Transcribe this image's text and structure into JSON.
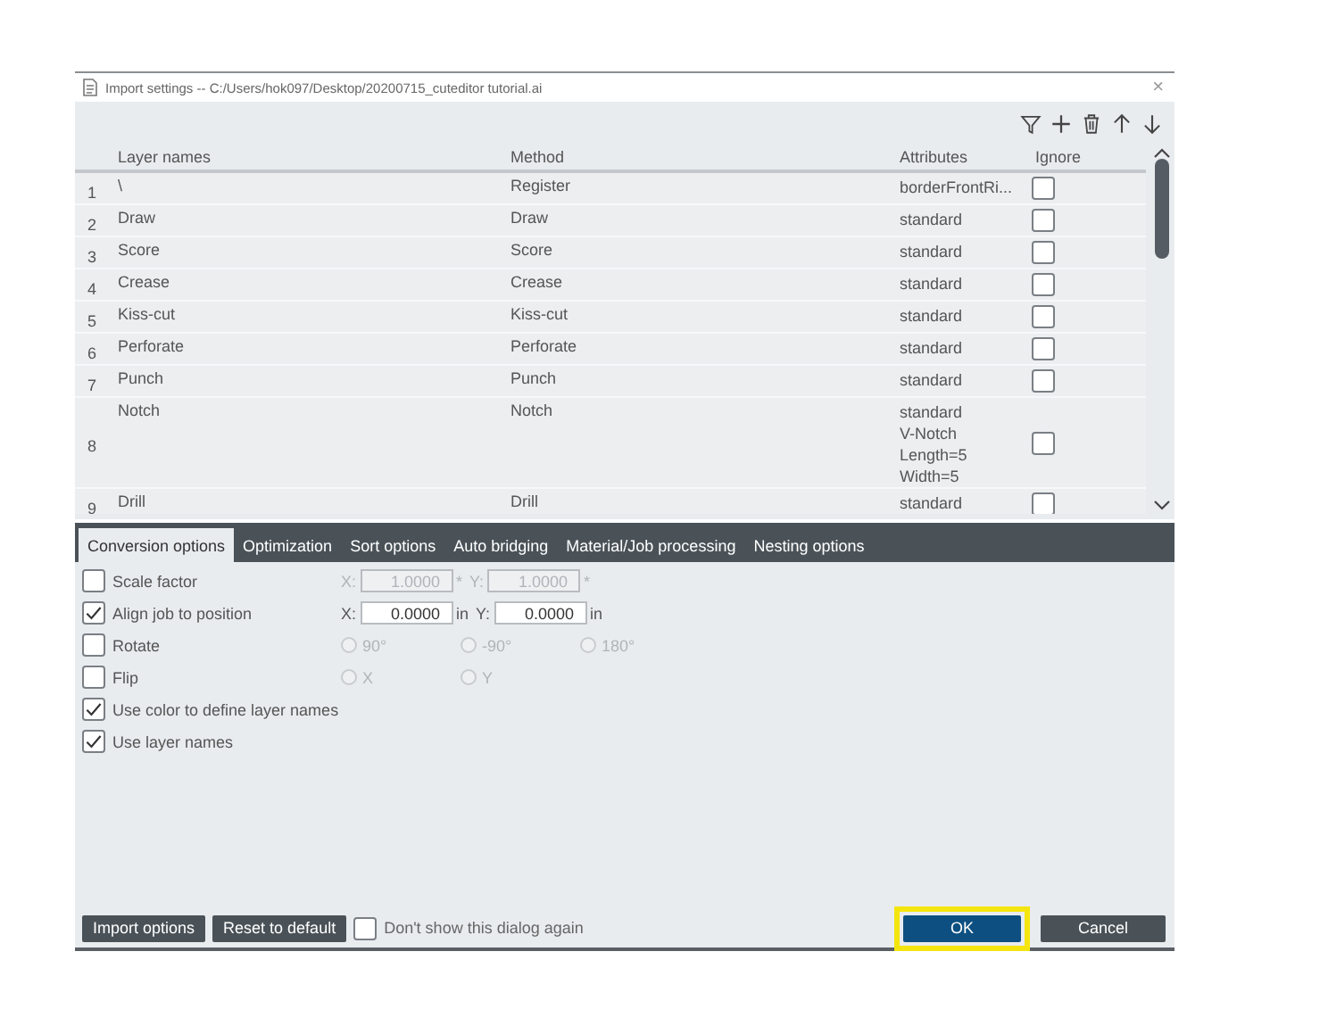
{
  "window": {
    "title": "Import settings  --  C:/Users/hok097/Desktop/20200715_cuteditor tutorial.ai",
    "close": "×"
  },
  "table": {
    "columns": [
      "Layer names",
      "Method",
      "Attributes",
      "Ignore"
    ],
    "rows": [
      {
        "number": "1",
        "layer": "\\",
        "method": "Register",
        "attributes": [
          "borderFrontRi..."
        ],
        "ignore": false
      },
      {
        "number": "2",
        "layer": "Draw",
        "method": "Draw",
        "attributes": [
          "standard"
        ],
        "ignore": false
      },
      {
        "number": "3",
        "layer": "Score",
        "method": "Score",
        "attributes": [
          "standard"
        ],
        "ignore": false
      },
      {
        "number": "4",
        "layer": "Crease",
        "method": "Crease",
        "attributes": [
          "standard"
        ],
        "ignore": false
      },
      {
        "number": "5",
        "layer": "Kiss-cut",
        "method": "Kiss-cut",
        "attributes": [
          "standard"
        ],
        "ignore": false
      },
      {
        "number": "6",
        "layer": "Perforate",
        "method": "Perforate",
        "attributes": [
          "standard"
        ],
        "ignore": false
      },
      {
        "number": "7",
        "layer": "Punch",
        "method": "Punch",
        "attributes": [
          "standard"
        ],
        "ignore": false
      },
      {
        "number": "8",
        "layer": "Notch",
        "method": "Notch",
        "attributes": [
          "standard",
          "V-Notch",
          "Length=5",
          "Width=5"
        ],
        "ignore": false
      },
      {
        "number": "9",
        "layer": "Drill",
        "method": "Drill",
        "attributes": [
          "standard"
        ],
        "ignore": false
      }
    ]
  },
  "tabs": [
    {
      "label": "Conversion options",
      "selected": true
    },
    {
      "label": "Optimization",
      "selected": false
    },
    {
      "label": "Sort options",
      "selected": false
    },
    {
      "label": "Auto bridging",
      "selected": false
    },
    {
      "label": "Material/Job processing",
      "selected": false
    },
    {
      "label": "Nesting options",
      "selected": false
    }
  ],
  "options": [
    {
      "kind": "fields",
      "label": "Scale factor",
      "checked": false,
      "disabled": true,
      "fields": [
        {
          "prefix": "X:",
          "value": "1.0000",
          "unit": "*"
        },
        {
          "prefix": "Y:",
          "value": "1.0000",
          "unit": "*"
        }
      ]
    },
    {
      "kind": "fields",
      "label": "Align job to position",
      "checked": true,
      "disabled": false,
      "fields": [
        {
          "prefix": "X:",
          "value": "0.0000",
          "unit": "in"
        },
        {
          "prefix": "Y:",
          "value": "0.0000",
          "unit": "in"
        }
      ]
    },
    {
      "kind": "radios",
      "label": "Rotate",
      "checked": false,
      "disabled": true,
      "choices": [
        {
          "label": "90°",
          "selected": false
        },
        {
          "label": "-90°",
          "selected": false
        },
        {
          "label": "180°",
          "selected": false
        }
      ]
    },
    {
      "kind": "radios",
      "label": "Flip",
      "checked": false,
      "disabled": true,
      "choices": [
        {
          "label": "X",
          "selected": false
        },
        {
          "label": "Y",
          "selected": false
        }
      ]
    },
    {
      "kind": "plain",
      "label": "Use color to define layer names",
      "checked": true
    },
    {
      "kind": "plain",
      "label": "Use layer names",
      "checked": true
    }
  ],
  "footer": {
    "buttons": [
      "Import options",
      "Reset to default"
    ],
    "dont_show": {
      "label": "Don't show this dialog again",
      "checked": false
    },
    "ok": {
      "label": "OK",
      "highlighted": true
    },
    "cancel": {
      "label": "Cancel"
    }
  }
}
